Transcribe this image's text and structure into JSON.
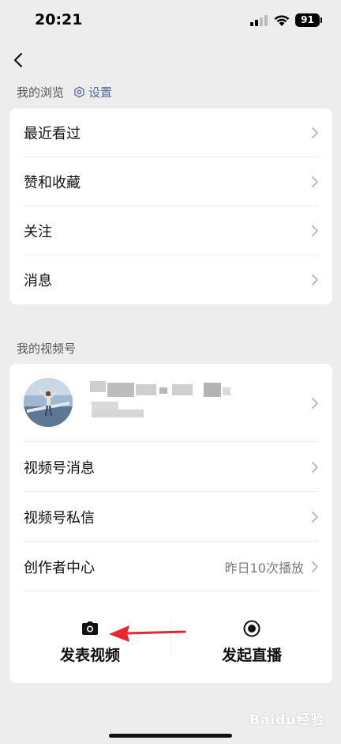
{
  "status_bar": {
    "time": "20:21",
    "battery": "91"
  },
  "browse_section": {
    "title": "我的浏览",
    "settings_label": "设置",
    "items": [
      {
        "label": "最近看过"
      },
      {
        "label": "赞和收藏"
      },
      {
        "label": "关注"
      },
      {
        "label": "消息"
      }
    ]
  },
  "channels_section": {
    "title": "我的视频号",
    "items": [
      {
        "label": "视频号消息"
      },
      {
        "label": "视频号私信"
      },
      {
        "label": "创作者中心",
        "sub": "昨日10次播放"
      }
    ],
    "actions": [
      {
        "label": "发表视频",
        "icon": "camera-icon"
      },
      {
        "label": "发起直播",
        "icon": "live-record-icon"
      }
    ]
  },
  "watermark": "Baidu经验",
  "colors": {
    "background": "#ededed",
    "card": "#ffffff",
    "link": "#576b95",
    "arrow": "#e8262d"
  }
}
